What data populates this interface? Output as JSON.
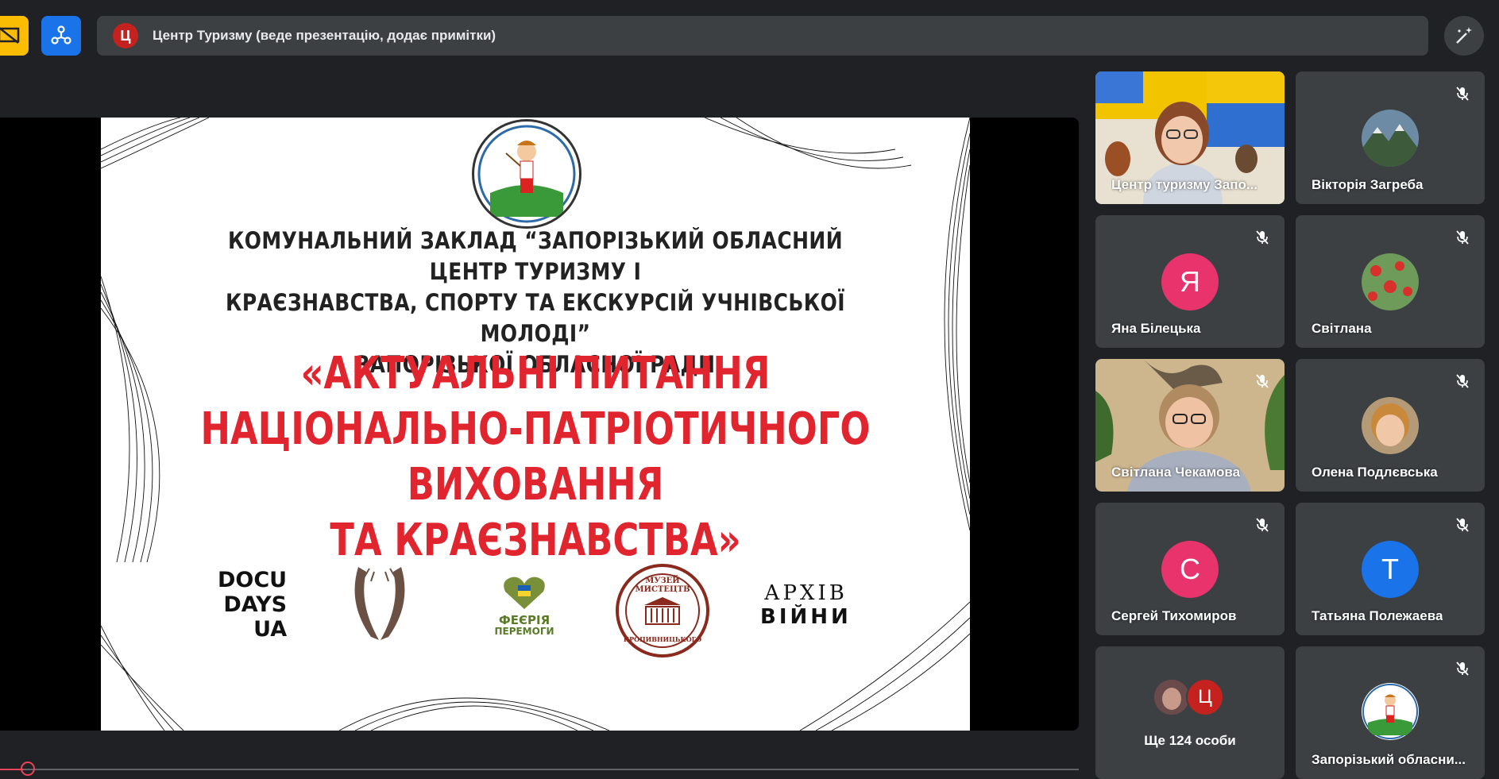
{
  "presenter_bar": {
    "avatar_letter": "Ц",
    "text": "Центр Туризму (веде презентацію, додає примітки)"
  },
  "slide": {
    "org_line1": "КОМУНАЛЬНИЙ ЗАКЛАД “ЗАПОРІЗЬКИЙ ОБЛАСНИЙ ЦЕНТР ТУРИЗМУ І",
    "org_line2": "КРАЄЗНАВСТВА, СПОРТУ ТА ЕКСКУРСІЙ УЧНІВСЬКОЇ МОЛОДІ”",
    "org_line3": "ЗАПОРІЗЬКОЇ ОБЛАСНОЇ РАДИ",
    "title_line1": "«АКТУАЛЬНІ ПИТАННЯ",
    "title_line2": "НАЦІОНАЛЬНО-ПАТРІОТИЧНОГО ВИХОВАННЯ",
    "title_line3": "ТА КРАЄЗНАВСТВА»",
    "logo_docu": [
      "DOCU",
      "DAYS",
      "UA"
    ],
    "logo_feeria": [
      "ФЕЄРІЯ",
      "ПЕРЕМОГИ"
    ],
    "logo_museum_top": "МУЗЕЙ МИСТЕЦТВ",
    "logo_museum_bottom": "КРОПИВНИЦЬКОГО",
    "logo_archive": [
      "АРХІВ",
      "ВІЙНИ"
    ]
  },
  "participants": [
    {
      "name": "Центр туризму Запо...",
      "muted": false,
      "type": "video"
    },
    {
      "name": "Вікторія Загреба",
      "muted": true,
      "type": "photo"
    },
    {
      "name": "Яна Білецька",
      "muted": true,
      "type": "letter",
      "letter": "Я",
      "color": "#e8336d"
    },
    {
      "name": "Світлана",
      "muted": true,
      "type": "photo"
    },
    {
      "name": "Світлана Чекамова",
      "muted": true,
      "type": "video"
    },
    {
      "name": "Олена Подлєвська",
      "muted": true,
      "type": "photo"
    },
    {
      "name": "Сергей Тихомиров",
      "muted": true,
      "type": "letter",
      "letter": "С",
      "color": "#e8336d"
    },
    {
      "name": "Татьяна Полежаева",
      "muted": true,
      "type": "letter",
      "letter": "Т",
      "color": "#1a73e8"
    },
    {
      "more": "Ще 124 особи",
      "avatar_letter": "Ц"
    },
    {
      "name": "Запорізький обласни...",
      "muted": true,
      "type": "photo"
    }
  ],
  "colors": {
    "background": "#202124",
    "tile": "#3c4043",
    "accent_red": "#e0252f"
  }
}
